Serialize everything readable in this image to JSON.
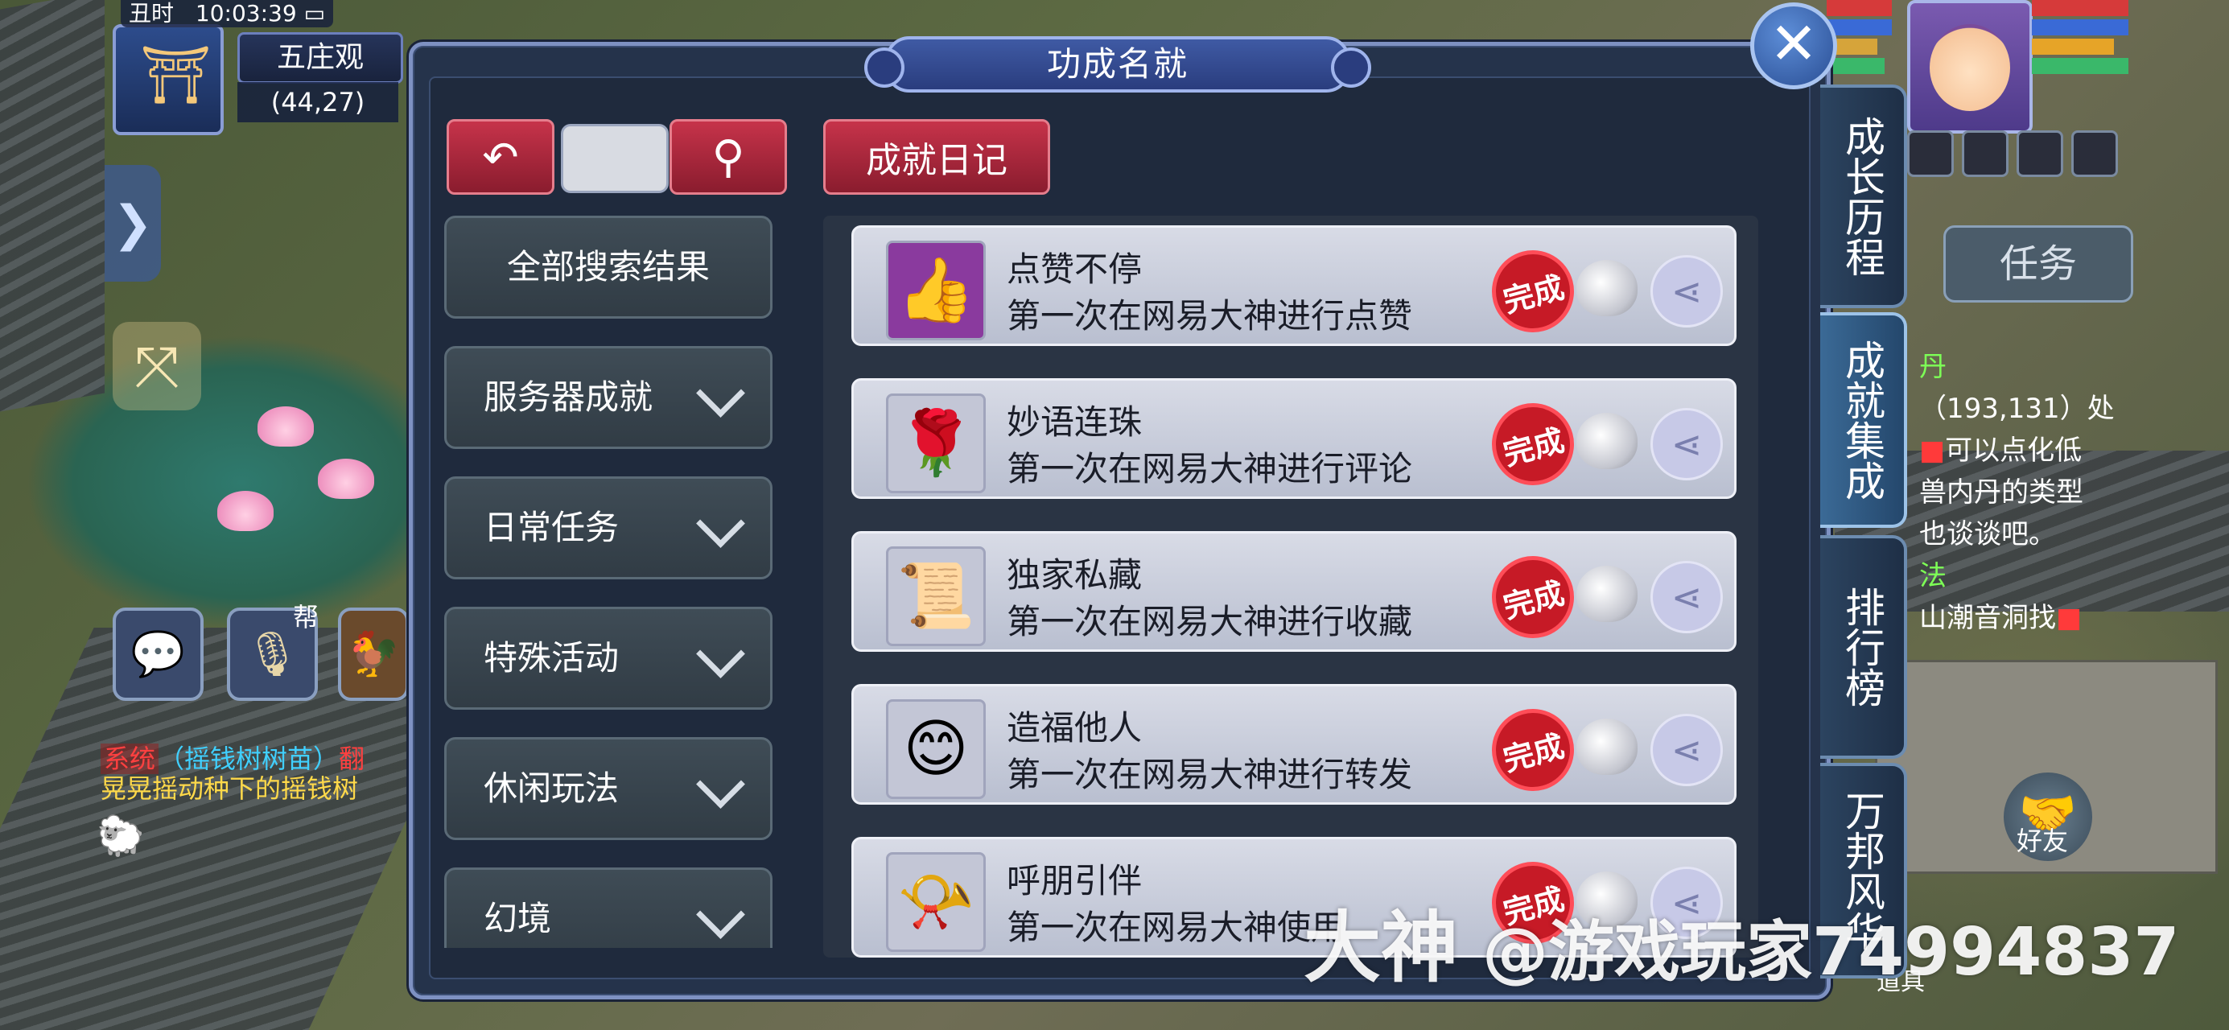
{
  "hud": {
    "shichen": "丑时",
    "clock": "10:03:39",
    "location": "五庄观",
    "coords": "(44,27)",
    "bang_label": "帮"
  },
  "chat": {
    "system_tag": "系统",
    "line1": "（摇钱树树苗）",
    "line1_suffix": "翻",
    "line2": "晃晃摇动种下的摇钱树"
  },
  "right_hud": {
    "task_tab": "任务",
    "task_lines": [
      {
        "text": "丹",
        "color": "green"
      },
      {
        "text": "（193,131）处",
        "color": "white"
      },
      {
        "text": "可以点化低",
        "color": "red-white"
      },
      {
        "text": "兽内丹的类型",
        "color": "white"
      },
      {
        "text": "也谈谈吧。",
        "color": "white"
      },
      {
        "text": "法",
        "color": "green"
      },
      {
        "text": "山潮音洞找",
        "color": "white"
      }
    ],
    "friend_label": "好友",
    "daoju_label": "道具"
  },
  "dialog": {
    "title": "功成名就",
    "close_icon": "close-icon",
    "back_icon": "back-arrow-icon",
    "search_icon": "search-icon",
    "diary_button": "成就日记",
    "categories": [
      {
        "label": "全部搜索结果",
        "expandable": false
      },
      {
        "label": "服务器成就",
        "expandable": true
      },
      {
        "label": "日常任务",
        "expandable": true
      },
      {
        "label": "特殊活动",
        "expandable": true
      },
      {
        "label": "休闲玩法",
        "expandable": true
      },
      {
        "label": "幻境",
        "expandable": true
      }
    ],
    "achievements": [
      {
        "name": "点赞不停",
        "desc": "第一次在网易大神进行点赞",
        "icon": "thumbs-up-icon",
        "status": "完成"
      },
      {
        "name": "妙语连珠",
        "desc": "第一次在网易大神进行评论",
        "icon": "rose-icon",
        "status": "完成"
      },
      {
        "name": "独家私藏",
        "desc": "第一次在网易大神进行收藏",
        "icon": "scroll-icon",
        "status": "完成"
      },
      {
        "name": "造福他人",
        "desc": "第一次在网易大神进行转发",
        "icon": "smiley-icon",
        "status": "完成"
      },
      {
        "name": "呼朋引伴",
        "desc": "第一次在网易大神使用",
        "icon": "horn-icon",
        "status": "完成"
      }
    ],
    "side_tabs": [
      "成长历程",
      "成就集成",
      "排行榜",
      "万邦风华"
    ],
    "active_tab": "成就集成"
  },
  "watermark": {
    "logo": "大神",
    "text": "@游戏玩家74994837"
  },
  "colors": {
    "dialog_bg": "#25334b",
    "accent_red": "#c6334a",
    "seal_red": "#c61a26",
    "tab_active": "#3b6a96"
  }
}
